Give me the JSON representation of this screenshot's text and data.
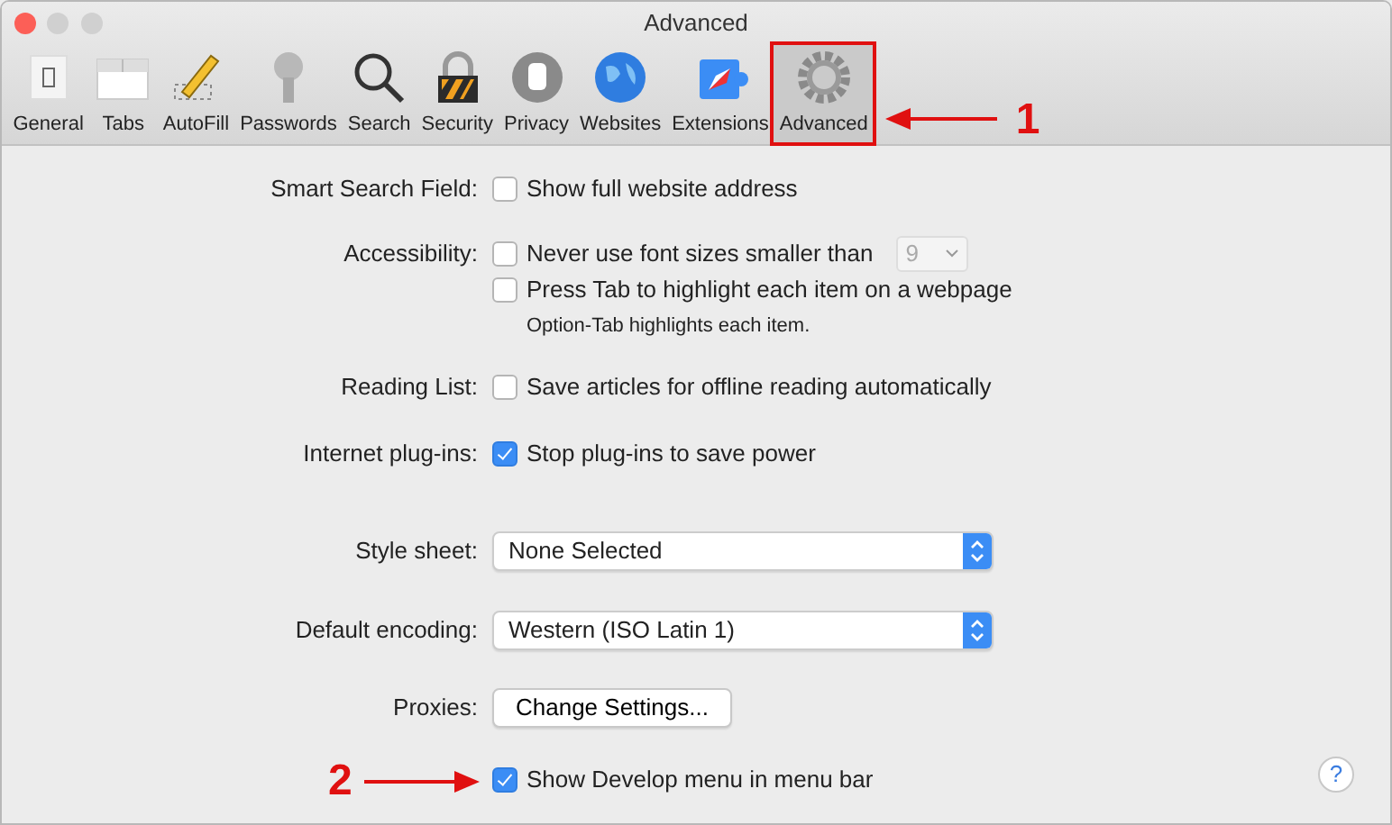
{
  "window": {
    "title": "Advanced"
  },
  "toolbar": [
    {
      "label": "General",
      "selected": false,
      "highlighted": false
    },
    {
      "label": "Tabs",
      "selected": false,
      "highlighted": false
    },
    {
      "label": "AutoFill",
      "selected": false,
      "highlighted": false
    },
    {
      "label": "Passwords",
      "selected": false,
      "highlighted": false
    },
    {
      "label": "Search",
      "selected": false,
      "highlighted": false
    },
    {
      "label": "Security",
      "selected": false,
      "highlighted": false
    },
    {
      "label": "Privacy",
      "selected": false,
      "highlighted": false
    },
    {
      "label": "Websites",
      "selected": false,
      "highlighted": false
    },
    {
      "label": "Extensions",
      "selected": false,
      "highlighted": false
    },
    {
      "label": "Advanced",
      "selected": true,
      "highlighted": true
    }
  ],
  "settings": [
    {
      "label": "Smart Search Field:",
      "controls": [
        {
          "kind": "checkbox",
          "text": "Show full website address",
          "checked": false
        }
      ]
    },
    {
      "label": "Accessibility:",
      "controls": [
        {
          "kind": "checkbox",
          "text": "Never use font sizes smaller than",
          "checked": false,
          "select": {
            "value": "9",
            "disabled": true
          }
        },
        {
          "kind": "checkbox",
          "text": "Press Tab to highlight each item on a webpage",
          "checked": false
        },
        {
          "kind": "note",
          "text": "Option-Tab highlights each item."
        }
      ]
    },
    {
      "label": "Reading List:",
      "controls": [
        {
          "kind": "checkbox",
          "text": "Save articles for offline reading automatically",
          "checked": false
        }
      ]
    },
    {
      "label": "Internet plug-ins:",
      "controls": [
        {
          "kind": "checkbox",
          "text": "Stop plug-ins to save power",
          "checked": true
        }
      ]
    },
    {
      "label": "Style sheet:",
      "controls": [
        {
          "kind": "select",
          "value": "None Selected"
        }
      ]
    },
    {
      "label": "Default encoding:",
      "controls": [
        {
          "kind": "select",
          "value": "Western (ISO Latin 1)"
        }
      ]
    },
    {
      "label": "Proxies:",
      "controls": [
        {
          "kind": "button",
          "text": "Change Settings..."
        }
      ]
    },
    {
      "controls": [
        {
          "kind": "checkbox",
          "text": "Show Develop menu in menu bar",
          "checked": true
        }
      ]
    }
  ],
  "help_button": "?",
  "callouts": [
    {
      "number": "1"
    },
    {
      "number": "2"
    }
  ]
}
